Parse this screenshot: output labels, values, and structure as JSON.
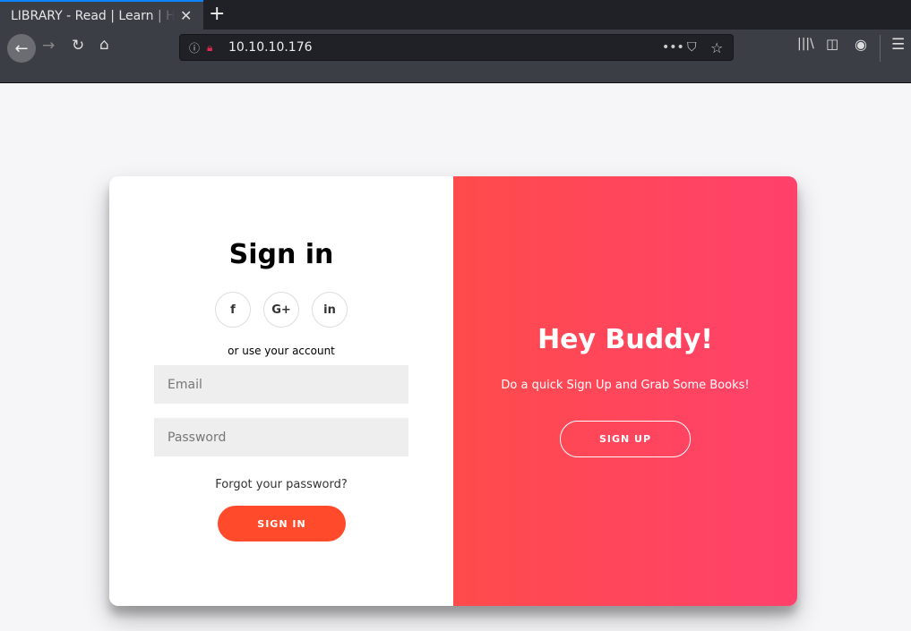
{
  "browser": {
    "tab_title": "LIBRARY - Read | Learn | Hav",
    "url": "10.10.10.176"
  },
  "signin": {
    "title": "Sign in",
    "social": [
      "f",
      "G+",
      "in"
    ],
    "alt_text": "or use your account",
    "email_placeholder": "Email",
    "password_placeholder": "Password",
    "forgot": "Forgot your password?",
    "button": "SIGN IN"
  },
  "overlay": {
    "title": "Hey Buddy!",
    "text": "Do a quick Sign Up and Grab Some Books!",
    "button": "SIGN UP"
  },
  "colors": {
    "accent": "#ff4b2b",
    "gradient_start": "#ff4b4b",
    "gradient_end": "#ff416c"
  }
}
